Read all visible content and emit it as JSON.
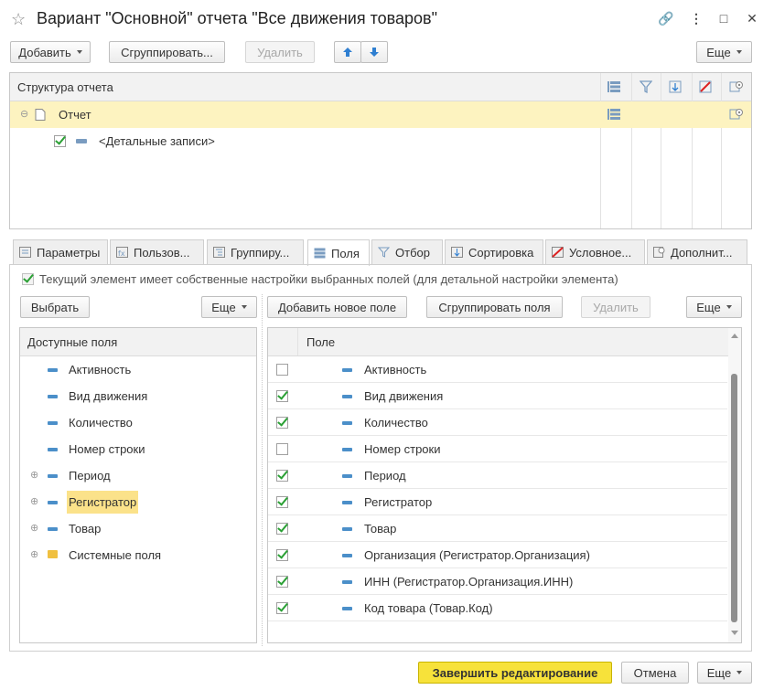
{
  "window": {
    "title": "Вариант \"Основной\" отчета \"Все движения товаров\""
  },
  "toolbar": {
    "add_label": "Добавить",
    "group_label": "Сгруппировать...",
    "delete_label": "Удалить",
    "more_label": "Еще"
  },
  "structure": {
    "header": "Структура отчета",
    "rows": [
      {
        "label": "Отчет"
      },
      {
        "label": "<Детальные записи>"
      }
    ]
  },
  "tabs": [
    {
      "label": "Параметры"
    },
    {
      "label": "Пользов..."
    },
    {
      "label": "Группиру..."
    },
    {
      "label": "Поля"
    },
    {
      "label": "Отбор"
    },
    {
      "label": "Сортировка"
    },
    {
      "label": "Условное..."
    },
    {
      "label": "Дополнит..."
    }
  ],
  "own_settings": {
    "label": "Текущий элемент имеет собственные настройки выбранных полей (для детальной настройки элемента)"
  },
  "left": {
    "select_label": "Выбрать",
    "more_label": "Еще",
    "header": "Доступные поля",
    "items": [
      {
        "label": "Активность"
      },
      {
        "label": "Вид движения"
      },
      {
        "label": "Количество"
      },
      {
        "label": "Номер строки"
      },
      {
        "label": "Период"
      },
      {
        "label": "Регистратор"
      },
      {
        "label": "Товар"
      },
      {
        "label": "Системные поля"
      }
    ]
  },
  "right": {
    "add_field_label": "Добавить новое поле",
    "group_label": "Сгруппировать поля",
    "delete_label": "Удалить",
    "more_label": "Еще",
    "header": "Поле",
    "items": [
      {
        "label": "Активность",
        "checked": false
      },
      {
        "label": "Вид движения",
        "checked": true
      },
      {
        "label": "Количество",
        "checked": true
      },
      {
        "label": "Номер строки",
        "checked": false
      },
      {
        "label": "Период",
        "checked": true
      },
      {
        "label": "Регистратор",
        "checked": true
      },
      {
        "label": "Товар",
        "checked": true
      },
      {
        "label": "Организация (Регистратор.Организация)",
        "checked": true
      },
      {
        "label": "ИНН (Регистратор.Организация.ИНН)",
        "checked": true
      },
      {
        "label": "Код товара (Товар.Код)",
        "checked": true
      }
    ]
  },
  "footer": {
    "finish_label": "Завершить редактирование",
    "cancel_label": "Отмена",
    "more_label": "Еще"
  },
  "colors": {
    "highlight": "#fdf3c0",
    "accent_yellow": "#f7e23a",
    "check_green": "#2aa034",
    "icon_blue": "#4b8fc9"
  }
}
